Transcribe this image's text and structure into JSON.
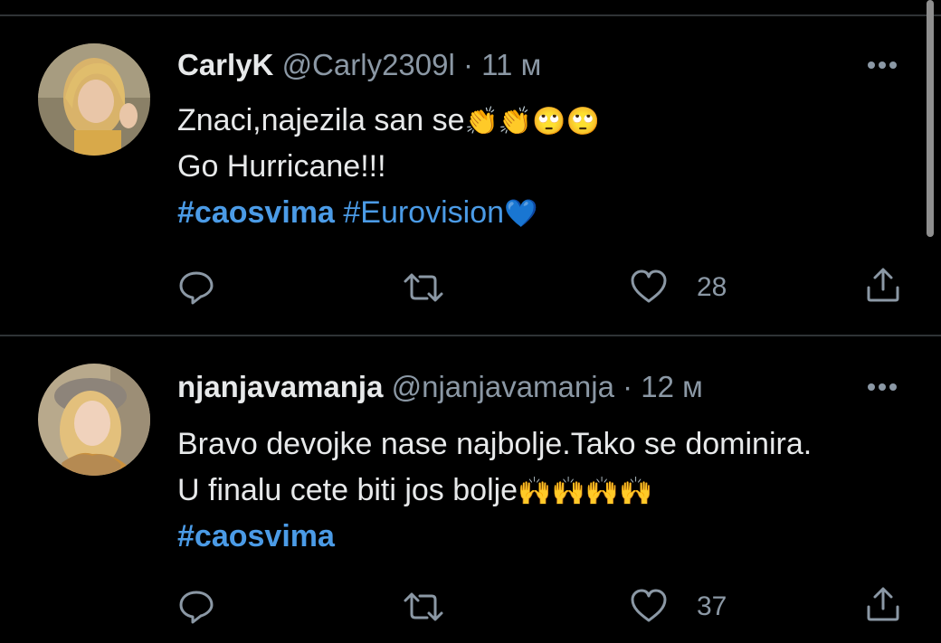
{
  "tweets": [
    {
      "name": "CarlyK",
      "handle": "@Carly2309l",
      "separator": "·",
      "time": "11 м",
      "lines": [
        {
          "text": "Znaci,najezila san se",
          "emoji": "👏👏🙄🙄"
        },
        {
          "text": "Go Hurricane!!!"
        }
      ],
      "hashtags": [
        "#caosvima",
        "#Eurovision"
      ],
      "hashtag_emoji": "💙",
      "likes": "28"
    },
    {
      "name": "njanjavamanja",
      "handle": "@njanjavamanja",
      "separator": "·",
      "time": "12 м",
      "lines": [
        {
          "text": "Bravo devojke nase najbolje.Tako se dominira."
        },
        {
          "text": "U finalu cete biti jos bolje",
          "emoji": "🙌🙌🙌🙌"
        }
      ],
      "hashtags": [
        "#caosvima"
      ],
      "likes": "37"
    }
  ],
  "icons": {
    "reply": "reply-icon",
    "retweet": "retweet-icon",
    "like": "heart-icon",
    "share": "share-icon",
    "more": "more-icon"
  },
  "colors": {
    "background": "#000000",
    "text": "#e7e9ea",
    "secondary": "#8b98a5",
    "link": "#4b9be6",
    "divider": "#2f3336"
  }
}
